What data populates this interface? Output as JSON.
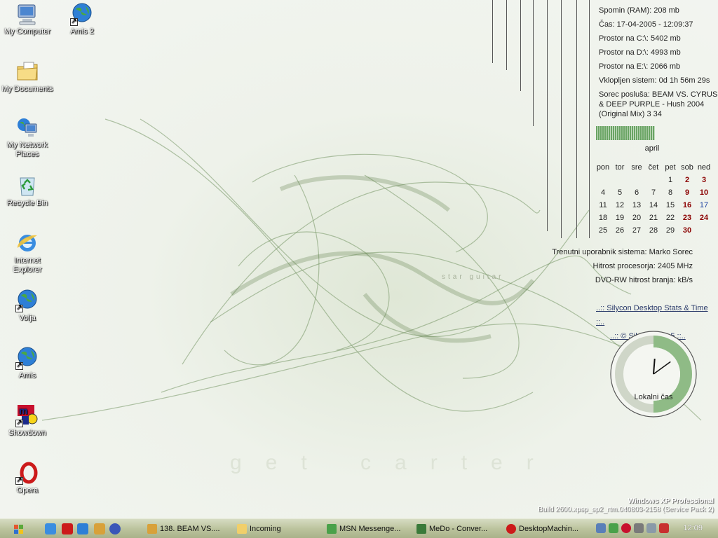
{
  "desktop": {
    "icons": [
      {
        "label": "My Computer",
        "icon": "my-computer-icon"
      },
      {
        "label": "Amis 2",
        "icon": "globe-shortcut-icon"
      },
      {
        "label": "My Documents",
        "icon": "folder-documents-icon"
      },
      {
        "label": "My Network Places",
        "icon": "network-places-icon"
      },
      {
        "label": "Recycle Bin",
        "icon": "recycle-bin-icon"
      },
      {
        "label": "Internet Explorer",
        "icon": "internet-explorer-icon"
      },
      {
        "label": "Volja",
        "icon": "globe-shortcut-icon"
      },
      {
        "label": "Amis",
        "icon": "globe-shortcut-icon"
      },
      {
        "label": "Showdown",
        "icon": "mirc-icon"
      },
      {
        "label": "Opera",
        "icon": "opera-icon"
      }
    ],
    "wallpaper_text": {
      "a": "star guitar",
      "b": "get carter"
    }
  },
  "stats": {
    "ram": "Spomin (RAM): 208 mb",
    "time": "Čas: 17-04-2005 - 12:09:37",
    "disk_c": "Prostor na C:\\: 5402 mb",
    "disk_d": "Prostor na D:\\: 4993 mb",
    "disk_e": "Prostor na E:\\: 2066 mb",
    "uptime": "Vklopljen sistem: 0d 1h 56m 29s",
    "now_playing": "Sorec posluša: BEAM VS. CYRUS & DEEP PURPLE - Hush 2004 (Original Mix) 3 34"
  },
  "calendar": {
    "month": "april",
    "weekdays": [
      "pon",
      "tor",
      "sre",
      "čet",
      "pet",
      "sob",
      "ned"
    ],
    "weeks": [
      [
        "",
        "",
        "",
        "",
        "1",
        "2",
        "3"
      ],
      [
        "4",
        "5",
        "6",
        "7",
        "8",
        "9",
        "10"
      ],
      [
        "11",
        "12",
        "13",
        "14",
        "15",
        "16",
        "17"
      ],
      [
        "18",
        "19",
        "20",
        "21",
        "22",
        "23",
        "24"
      ],
      [
        "25",
        "26",
        "27",
        "28",
        "29",
        "30",
        ""
      ]
    ],
    "today": "17"
  },
  "info": {
    "user": "Trenutni uporabnik sistema: Marko Sorec",
    "cpu": "Hitrost procesorja: 2405 MHz",
    "dvd": "DVD-RW hitrost branja:  kB/s"
  },
  "links": {
    "stats_link": "..:: Silycon Desktop Stats & Time ::..",
    "copyright_link": "..:: © Silycon, 2oo5 ::.."
  },
  "clock": {
    "label": "Lokalni čas",
    "hour": 12,
    "minute": 9
  },
  "windows": {
    "edition": "Windows XP Professional",
    "build": "Build 2600.xpsp_sp2_rtm.040803-2158 (Service Pack 2)"
  },
  "taskbar": {
    "tasks": [
      {
        "label": "138. BEAM VS....",
        "icon": "winamp-icon"
      },
      {
        "label": "Incoming",
        "icon": "folder-icon"
      },
      {
        "label": "MSN Messenge...",
        "icon": "msn-icon"
      },
      {
        "label": "MeDo - Conver...",
        "icon": "chat-icon"
      },
      {
        "label": "DesktopMachin...",
        "icon": "opera-icon"
      }
    ],
    "time": "12:09"
  },
  "colors": {
    "accent": "#6aa464",
    "weekend": "#8b0000",
    "today": "#1a3fa0",
    "taskbar": "#bcc49e"
  }
}
